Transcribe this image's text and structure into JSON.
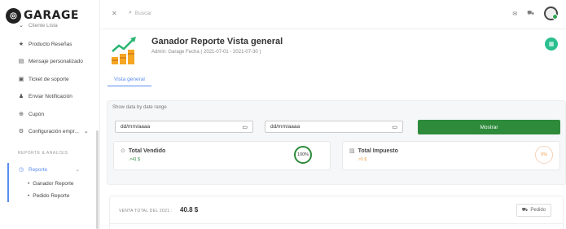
{
  "sidebar": {
    "logo_text": "GARAGE",
    "cut_item": "Cliente Lista",
    "items": [
      {
        "label": "Producto Reseñas",
        "icon": "star-icon"
      },
      {
        "label": "Mensaje personalizado",
        "icon": "message-icon"
      },
      {
        "label": "Ticket de soporte",
        "icon": "ticket-icon"
      },
      {
        "label": "Enviar Notificación",
        "icon": "bell-icon"
      },
      {
        "label": "Cupón",
        "icon": "gift-icon"
      },
      {
        "label": "Configuración empr...",
        "icon": "gear-icon"
      }
    ],
    "section_label": "REPORTE & ANALISIS",
    "reporte_label": "Reporte",
    "sub_items": [
      "Ganador Reporte",
      "Pedido Reporte"
    ]
  },
  "topbar": {
    "search_placeholder": "Buscar"
  },
  "header": {
    "title": "Ganador Reporte Vista general",
    "subtitle": "Admin: Garage   Fecha  ( 2021-07-01 - 2021-07-30 )",
    "tab": "Vista general"
  },
  "filter": {
    "label": "Show data by date range",
    "date_placeholder_1": "dd/mm/aaaa",
    "date_placeholder_2": "dd/mm/aaaa",
    "button": "Mostrar"
  },
  "stats": [
    {
      "title": "Total Vendido",
      "value": "↗41 $",
      "ring": "100%"
    },
    {
      "title": "Total Impuesto",
      "value": "↗0 $",
      "ring": "0%"
    }
  ],
  "bottom": {
    "total_label": "VENTA TOTAL DEL 2021 :",
    "total_value": "40.8 $",
    "pedido_button": "Pedido"
  },
  "colors": {
    "primary_green": "#2e8b3b",
    "accent_blue": "#5b8def",
    "teal_button": "#2bbf8f",
    "orange": "#f0a04b"
  }
}
